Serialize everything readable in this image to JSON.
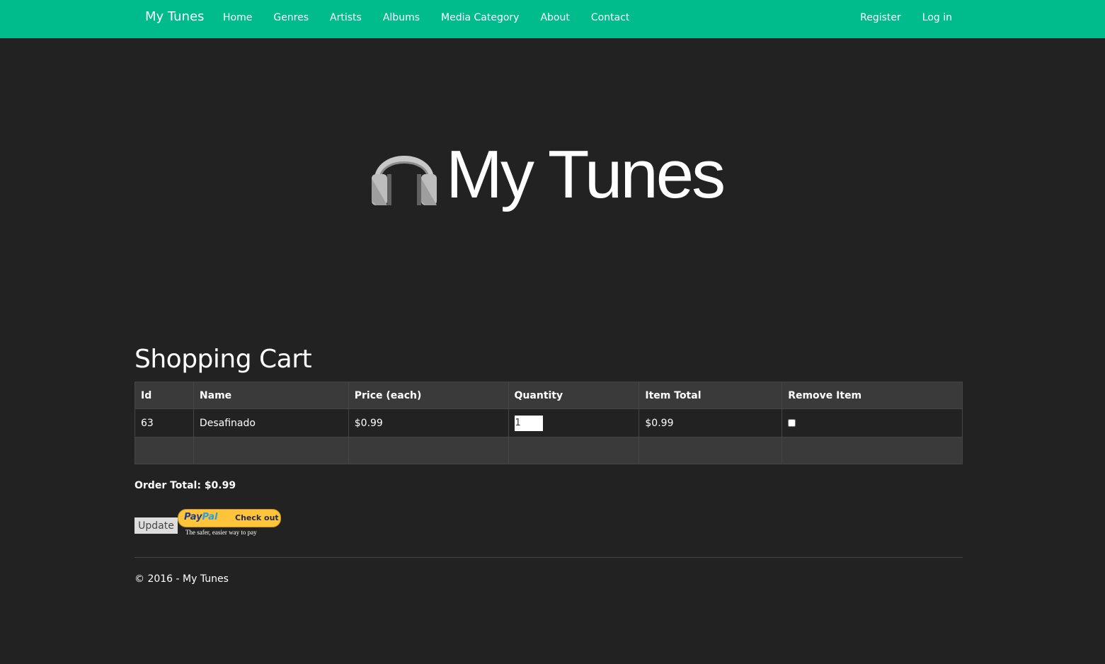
{
  "nav": {
    "brand": "My Tunes",
    "links": [
      "Home",
      "Genres",
      "Artists",
      "Albums",
      "Media Category",
      "About",
      "Contact"
    ],
    "right_links": [
      "Register",
      "Log in"
    ],
    "color": "#00bc8c"
  },
  "hero": {
    "title": "My Tunes",
    "icon": "headphones-icon"
  },
  "cart": {
    "title": "Shopping Cart",
    "headers": [
      "Id",
      "Name",
      "Price (each)",
      "Quantity",
      "Item Total",
      "Remove Item"
    ],
    "rows": [
      {
        "id": "63",
        "name": "Desafinado",
        "price": "$0.99",
        "quantity": "1",
        "item_total": "$0.99",
        "remove": false
      }
    ]
  },
  "order_total": "Order Total: $0.99",
  "buttons": {
    "update": "Update",
    "paypal": {
      "logo_pay": "Pay",
      "logo_pal": "Pal",
      "label": "Check out",
      "tagline": "The safer, easier way to pay"
    }
  },
  "footer": "© 2016 - My Tunes",
  "colors": {
    "background": "#222222",
    "table_header": "#3a3a3a",
    "accent": "#00bc8c",
    "paypal": "#ffc439"
  }
}
